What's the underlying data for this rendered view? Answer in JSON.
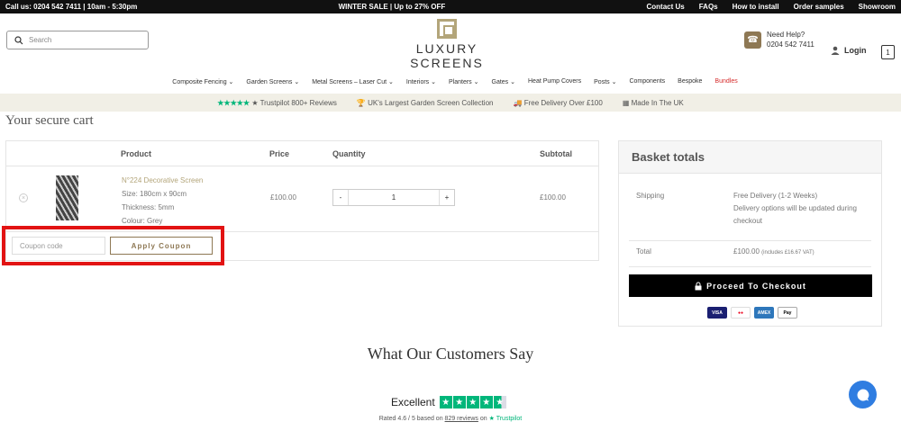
{
  "topbar": {
    "call": "Call us: 0204 542 7411 | 10am - 5:30pm",
    "sale": "WINTER SALE | Up to 27% OFF",
    "links": [
      "Contact Us",
      "FAQs",
      "How to install",
      "Order samples",
      "Showroom"
    ]
  },
  "header": {
    "search_placeholder": "Search",
    "logo_text": "LUXURY SCREENS",
    "help_title": "Need Help?",
    "help_phone": "0204 542 7411",
    "login": "Login",
    "cart_count": "1"
  },
  "nav": {
    "items": [
      "Composite Fencing",
      "Garden Screens",
      "Metal Screens – Laser Cut",
      "Interiors",
      "Planters",
      "Gates",
      "Heat Pump Covers",
      "Posts",
      "Components",
      "Bespoke",
      "Bundles"
    ],
    "bundles_color": "#d62d2d"
  },
  "usp": {
    "reviews": "800+ Reviews",
    "trustpilot": "★ Trustpilot",
    "collection": "UK's Largest Garden Screen Collection",
    "delivery": "Free Delivery Over £100",
    "made": "Made In The UK"
  },
  "cart": {
    "title": "Your secure cart",
    "headers": {
      "product": "Product",
      "price": "Price",
      "quantity": "Quantity",
      "subtotal": "Subtotal"
    },
    "item": {
      "name": "N°224 Decorative Screen",
      "size": "Size: 180cm x 90cm",
      "thickness": "Thickness: 5mm",
      "colour": "Colour: Grey",
      "price": "£100.00",
      "quantity": "1",
      "subtotal": "£100.00"
    },
    "coupon_placeholder": "Coupon code",
    "coupon_button": "Apply Coupon"
  },
  "totals": {
    "title": "Basket totals",
    "shipping_label": "Shipping",
    "shipping_value": "Free Delivery (1-2 Weeks)",
    "shipping_note": "Delivery options will be updated during checkout",
    "total_label": "Total",
    "total_value": "£100.00",
    "total_vat": "(includes £16.67 VAT)",
    "checkout_button": "Proceed To Checkout",
    "cards": [
      "VISA",
      "MC",
      "AMEX",
      "Pay"
    ]
  },
  "reviews": {
    "title": "What Our Customers Say",
    "excellent": "Excellent",
    "rated_prefix": "Rated 4.6 / 5 based on",
    "count_link": "829 reviews",
    "on": "on",
    "trustpilot": "★ Trustpilot"
  },
  "colors": {
    "accent": "#8e7854",
    "trustpilot": "#00b67a",
    "highlight": "#e21313"
  }
}
